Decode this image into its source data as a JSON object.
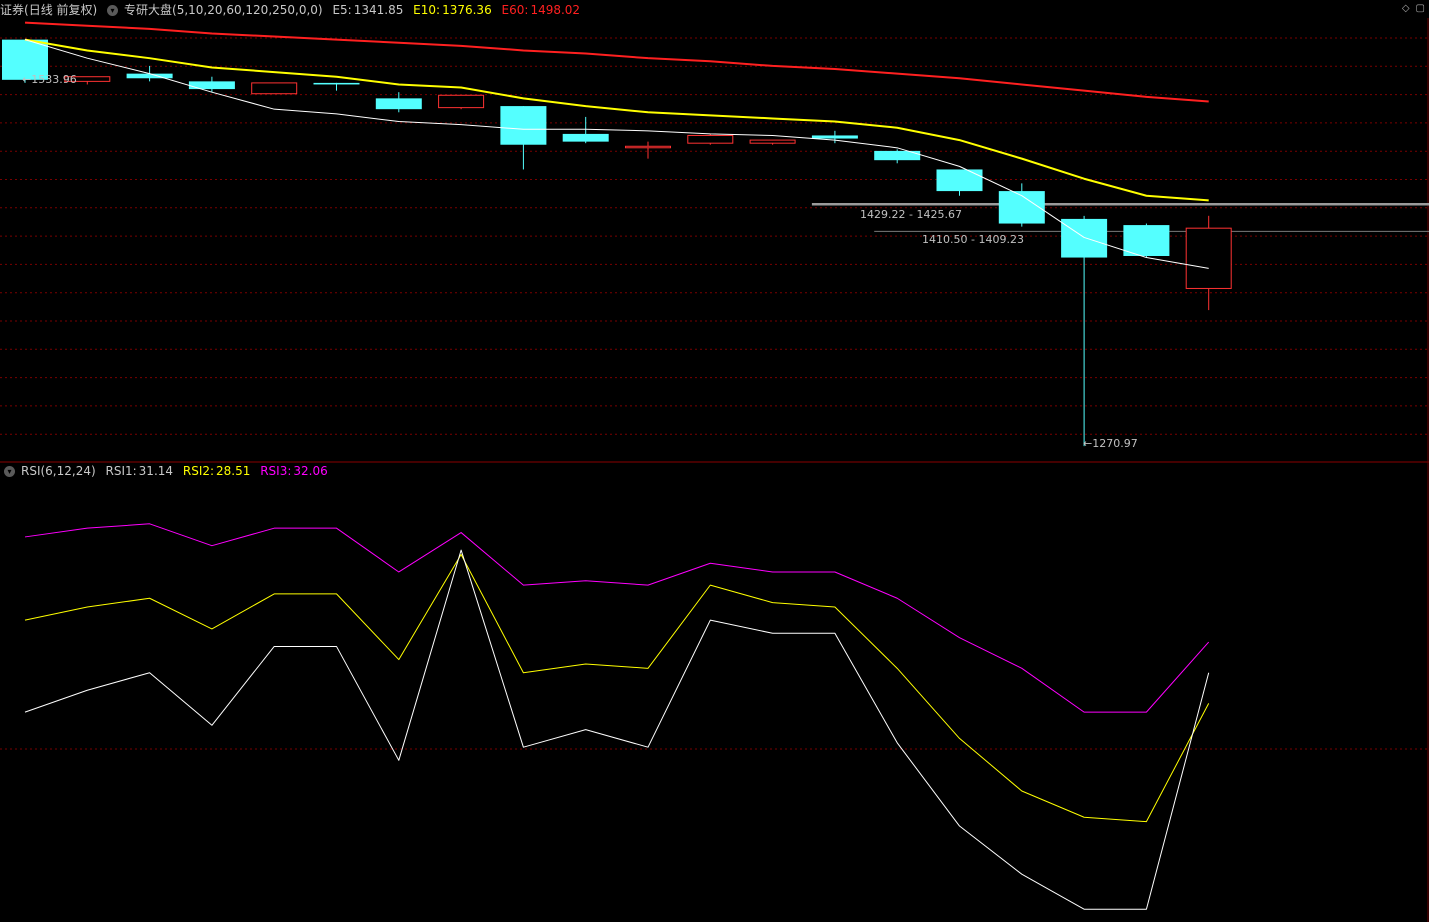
{
  "header": {
    "security": "证券",
    "period": "(日线 前复权)",
    "indicator_name": "专研大盘(5,10,20,60,120,250,0,0)",
    "ma_values": [
      {
        "label": "E5:",
        "value": "1341.85",
        "color": "#ffffff"
      },
      {
        "label": "E10:",
        "value": "1376.36",
        "color": "#ffff00"
      },
      {
        "label": "E60:",
        "value": "1498.02",
        "color": "#ff2020"
      }
    ],
    "window_buttons": [
      "◇",
      "▢"
    ]
  },
  "rsi_header": {
    "name": "RSI(6,12,24)",
    "values": [
      {
        "label": "RSI1:",
        "value": "31.14",
        "color": "#ffffff"
      },
      {
        "label": "RSI2:",
        "value": "28.51",
        "color": "#ffff00"
      },
      {
        "label": "RSI3:",
        "value": "32.06",
        "color": "#ff00ff"
      }
    ]
  },
  "annotations": {
    "high_label": "1533.96",
    "low_label": "1270.97",
    "gap1_label": "1429.22 - 1425.67",
    "gap2_label": "1410.50 - 1409.23"
  },
  "colors": {
    "up": "#ff3232",
    "down": "#54ffff",
    "e5": "#ffffff",
    "e10": "#ffff00",
    "e60": "#ff2020",
    "rsi1": "#ffffff",
    "rsi2": "#ffff00",
    "rsi3": "#ff00ff",
    "grid": "#7a0000"
  },
  "chart_data": [
    {
      "type": "candlestick",
      "price_range": [
        1262,
        1548
      ],
      "candles": [
        {
          "o": 1534,
          "h": 1534,
          "l": 1506,
          "c": 1508
        },
        {
          "o": 1507,
          "h": 1509,
          "l": 1505,
          "c": 1510
        },
        {
          "o": 1512,
          "h": 1517,
          "l": 1507,
          "c": 1509
        },
        {
          "o": 1507,
          "h": 1510,
          "l": 1500,
          "c": 1502
        },
        {
          "o": 1499,
          "h": 1506,
          "l": 1499,
          "c": 1506
        },
        {
          "o": 1506,
          "h": 1506,
          "l": 1501,
          "c": 1505
        },
        {
          "o": 1496,
          "h": 1500,
          "l": 1487,
          "c": 1489
        },
        {
          "o": 1490,
          "h": 1498,
          "l": 1489,
          "c": 1498
        },
        {
          "o": 1491,
          "h": 1491,
          "l": 1450,
          "c": 1466
        },
        {
          "o": 1473,
          "h": 1484,
          "l": 1467,
          "c": 1468
        },
        {
          "o": 1465,
          "h": 1468,
          "l": 1457,
          "c": 1465
        },
        {
          "o": 1467,
          "h": 1473,
          "l": 1466,
          "c": 1472
        },
        {
          "o": 1467,
          "h": 1469,
          "l": 1466,
          "c": 1469
        },
        {
          "o": 1472,
          "h": 1475,
          "l": 1467,
          "c": 1470
        },
        {
          "o": 1462,
          "h": 1463,
          "l": 1454,
          "c": 1456
        },
        {
          "o": 1450,
          "h": 1450,
          "l": 1433,
          "c": 1436
        },
        {
          "o": 1436,
          "h": 1441,
          "l": 1413,
          "c": 1415
        },
        {
          "o": 1418,
          "h": 1420,
          "l": 1271,
          "c": 1393
        },
        {
          "o": 1414,
          "h": 1415,
          "l": 1393,
          "c": 1394
        },
        {
          "o": 1373,
          "h": 1420,
          "l": 1359,
          "c": 1412
        }
      ],
      "e5": [
        1534,
        1522,
        1512,
        1500,
        1489,
        1486,
        1481,
        1479,
        1476,
        1476,
        1475,
        1473,
        1472,
        1469,
        1464,
        1452,
        1433,
        1406,
        1393,
        1386
      ],
      "e10": [
        1534,
        1527,
        1522,
        1516,
        1513,
        1510,
        1505,
        1503,
        1496,
        1491,
        1487,
        1485,
        1483,
        1481,
        1477,
        1469,
        1457,
        1444,
        1433,
        1430
      ],
      "e60": [
        1545,
        1543,
        1541,
        1538,
        1536,
        1534,
        1532,
        1530,
        1527,
        1525,
        1522,
        1520,
        1517,
        1515,
        1512,
        1509,
        1505,
        1501,
        1497,
        1494
      ],
      "gap_lines": [
        {
          "price": 1427.5,
          "from_index": 13
        },
        {
          "price": 1409.9,
          "from_index": 14
        }
      ]
    },
    {
      "type": "line",
      "title": "RSI(6,12,24)",
      "ylim": [
        0,
        100
      ],
      "series": [
        {
          "name": "RSI1",
          "color": "#ffffff",
          "values": [
            47,
            52,
            56,
            44,
            62,
            62,
            36,
            84,
            39,
            43,
            39,
            68,
            65,
            65,
            40,
            21,
            10,
            2,
            2,
            56
          ]
        },
        {
          "name": "RSI2",
          "color": "#ffff00",
          "values": [
            68,
            71,
            73,
            66,
            74,
            74,
            59,
            83,
            56,
            58,
            57,
            76,
            72,
            71,
            57,
            41,
            29,
            23,
            22,
            49
          ]
        },
        {
          "name": "RSI3",
          "color": "#ff00ff",
          "values": [
            87,
            89,
            90,
            85,
            89,
            89,
            79,
            88,
            76,
            77,
            76,
            81,
            79,
            79,
            73,
            64,
            57,
            47,
            47,
            63
          ]
        }
      ]
    }
  ]
}
